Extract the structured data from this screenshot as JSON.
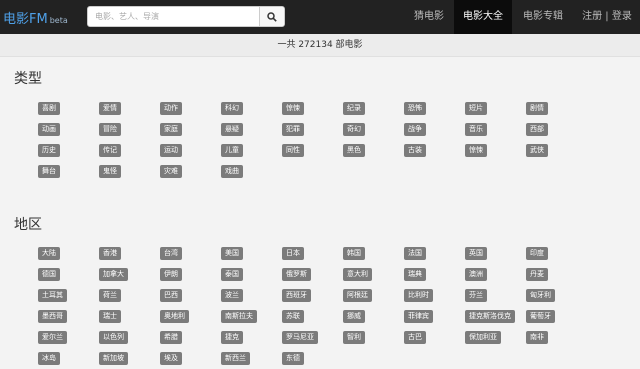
{
  "header": {
    "logo": "电影FM",
    "beta": "beta",
    "search_placeholder": "电影、艺人、导演",
    "nav": [
      "猜电影",
      "电影大全",
      "电影专辑",
      "注册 | 登录"
    ]
  },
  "total_text": "一共 272134 部电影",
  "genre_title": "类型",
  "genres": [
    [
      "喜剧",
      "爱情",
      "动作",
      "科幻",
      "惊悚",
      "纪录",
      "恐怖",
      "短片",
      "剧情"
    ],
    [
      "动画",
      "冒险",
      "家庭",
      "悬疑",
      "犯罪",
      "奇幻",
      "战争",
      "音乐",
      "西部"
    ],
    [
      "历史",
      "传记",
      "运动",
      "儿童",
      "同性",
      "黑色",
      "古装",
      "惊悚",
      "武侠"
    ],
    [
      "舞台",
      "鬼怪",
      "灾难",
      "戏曲"
    ]
  ],
  "region_title": "地区",
  "regions": [
    [
      "大陆",
      "香港",
      "台湾",
      "美国",
      "日本",
      "韩国",
      "法国",
      "英国",
      "印度"
    ],
    [
      "德国",
      "加拿大",
      "伊朗",
      "泰国",
      "俄罗斯",
      "意大利",
      "瑞典",
      "澳洲",
      "丹麦"
    ],
    [
      "土耳其",
      "荷兰",
      "巴西",
      "波兰",
      "西班牙",
      "阿根廷",
      "比利时",
      "芬兰",
      "匈牙利"
    ],
    [
      "墨西哥",
      "瑞士",
      "奥地利",
      "南斯拉夫",
      "苏联",
      "挪威",
      "菲律宾",
      "捷克斯洛伐克",
      "葡萄牙"
    ],
    [
      "爱尔兰",
      "以色列",
      "希腊",
      "捷克",
      "罗马尼亚",
      "智利",
      "古巴",
      "保加利亚",
      "南非"
    ],
    [
      "冰岛",
      "新加坡",
      "埃及",
      "新西兰",
      "东德"
    ]
  ]
}
